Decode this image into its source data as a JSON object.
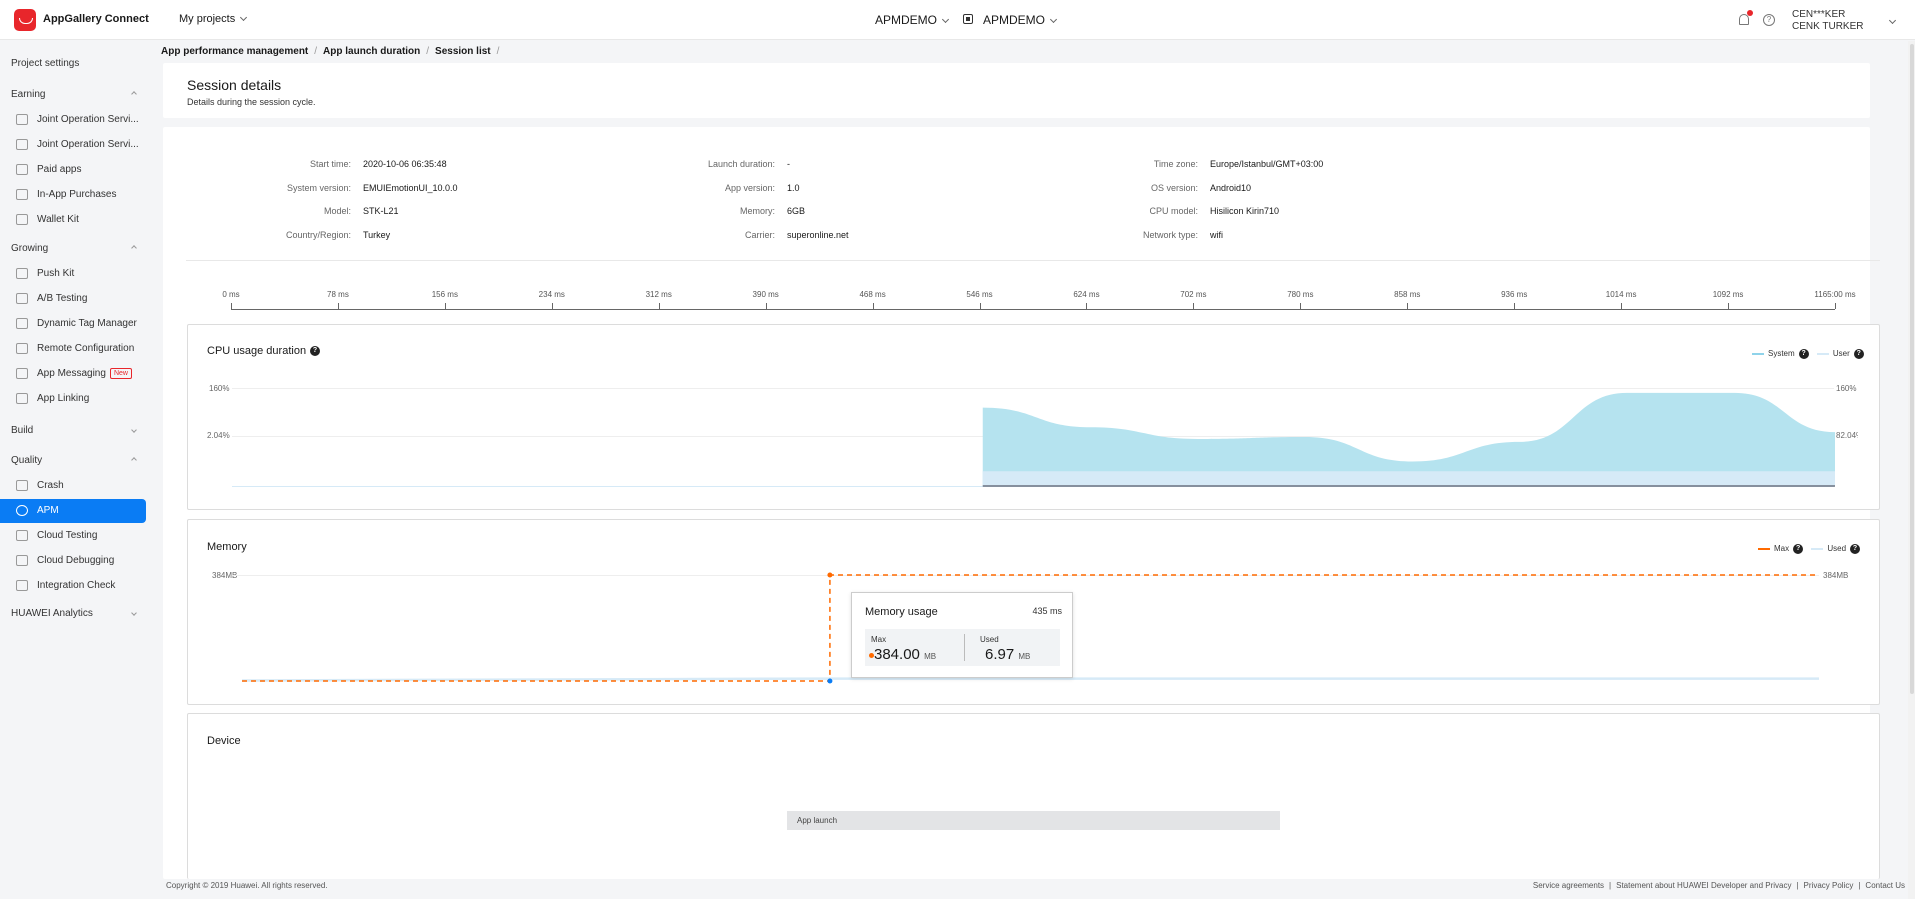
{
  "topbar": {
    "brand": "AppGallery Connect",
    "my_projects": "My projects",
    "project_1": "APMDEMO",
    "project_2": "APMDEMO",
    "user_short": "CEN***KER",
    "user_full": "CENK TURKER"
  },
  "sidebar": {
    "project_settings": "Project settings",
    "sections": {
      "earning": "Earning",
      "growing": "Growing",
      "build": "Build",
      "quality": "Quality",
      "analytics": "HUAWEI Analytics"
    },
    "earning_items": [
      "Joint Operation Servi...",
      "Joint Operation Servi...",
      "Paid apps",
      "In-App Purchases",
      "Wallet Kit"
    ],
    "growing_items": [
      "Push Kit",
      "A/B Testing",
      "Dynamic Tag Manager",
      "Remote Configuration",
      "App Messaging",
      "App Linking"
    ],
    "new_badge": "New",
    "quality_items": [
      "Crash",
      "APM",
      "Cloud Testing",
      "Cloud Debugging",
      "Integration Check"
    ],
    "active_item": "APM",
    "active_color": "#0a7cf4"
  },
  "breadcrumb": [
    "App performance management",
    "App launch duration",
    "Session list"
  ],
  "session": {
    "title": "Session details",
    "subtitle": "Details during the session cycle."
  },
  "info": {
    "start_time_label": "Start time:",
    "start_time": "2020-10-06 06:35:48",
    "system_version_label": "System version:",
    "system_version": "EMUIEmotionUI_10.0.0",
    "model_label": "Model:",
    "model": "STK-L21",
    "country_label": "Country/Region:",
    "country": "Turkey",
    "launch_duration_label": "Launch duration:",
    "launch_duration": "-",
    "app_version_label": "App version:",
    "app_version": "1.0",
    "memory_label": "Memory:",
    "memory": "6GB",
    "carrier_label": "Carrier:",
    "carrier": "superonline.net",
    "timezone_label": "Time zone:",
    "timezone": "Europe/Istanbul/GMT+03:00",
    "os_version_label": "OS version:",
    "os_version": "Android10",
    "cpu_model_label": "CPU model:",
    "cpu_model": "Hisilicon Kirin710",
    "network_label": "Network type:",
    "network": "wifi"
  },
  "timeline": {
    "ticks": [
      "0 ms",
      "78 ms",
      "156 ms",
      "234 ms",
      "312 ms",
      "390 ms",
      "468 ms",
      "546 ms",
      "624 ms",
      "702 ms",
      "780 ms",
      "858 ms",
      "936 ms",
      "1014 ms",
      "1092 ms",
      "1165:00 ms"
    ]
  },
  "cpu": {
    "title": "CPU usage duration",
    "legend_system": "System",
    "legend_user": "User",
    "y_top": "160%",
    "y_mid": "2.04%",
    "y_top_right": "160%",
    "y_mid_right": "82.04%",
    "system_color": "#b5e3ef",
    "user_color": "#d6eaf7"
  },
  "memory": {
    "title": "Memory",
    "legend_max": "Max",
    "legend_used": "Used",
    "y_top": "384MB",
    "y_top_right": "384MB",
    "max_color": "#ff6a00",
    "used_color": "#d6eaf7",
    "tooltip": {
      "title": "Memory usage",
      "time": "435 ms",
      "max_label": "Max",
      "max_value": "384.00",
      "max_unit": "MB",
      "used_label": "Used",
      "used_value": "6.97",
      "used_unit": "MB"
    }
  },
  "device": {
    "title": "Device",
    "app_launch": "App launch"
  },
  "chart_data": [
    {
      "type": "area",
      "title": "CPU usage duration",
      "x": [
        546,
        624,
        702,
        780,
        858,
        936,
        1014,
        1092,
        1165
      ],
      "series": [
        {
          "name": "System",
          "values": [
            80,
            60,
            48,
            50,
            25,
            45,
            95,
            95,
            55
          ]
        },
        {
          "name": "User",
          "values": [
            15,
            15,
            15,
            15,
            15,
            15,
            15,
            15,
            15
          ]
        }
      ],
      "xlabel": "",
      "ylabel": ""
    },
    {
      "type": "line",
      "title": "Memory",
      "x": [
        0,
        435,
        435,
        1165
      ],
      "series": [
        {
          "name": "Max",
          "values": [
            0,
            0,
            384,
            384
          ]
        },
        {
          "name": "Used",
          "values": [
            0,
            6.97,
            6.97,
            6.97
          ]
        }
      ],
      "xlabel": "",
      "ylabel": ""
    }
  ],
  "footer": {
    "copyright": "Copyright © 2019 Huawei. All rights reserved.",
    "links": [
      "Service agreements",
      "Statement about HUAWEI Developer and Privacy",
      "Privacy Policy",
      "Contact Us"
    ]
  }
}
